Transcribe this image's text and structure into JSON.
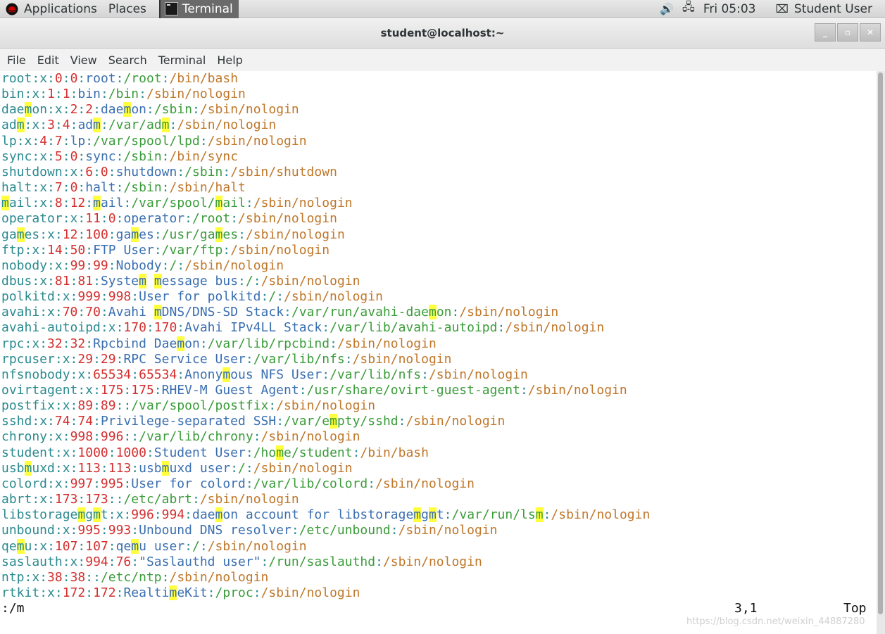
{
  "top_panel": {
    "applications": "Applications",
    "places": "Places",
    "taskbar_terminal": "Terminal",
    "clock": "Fri 05:03",
    "user": "Student User",
    "icons": [
      "redhat-icon",
      "terminal-icon",
      "volume-icon",
      "network-icon",
      "user-icon"
    ]
  },
  "window": {
    "title": "student@localhost:~",
    "controls": [
      "_",
      "▫",
      "✕"
    ]
  },
  "menubar": [
    "File",
    "Edit",
    "View",
    "Search",
    "Terminal",
    "Help"
  ],
  "terminal": {
    "lines": [
      "root:x:0:0:root:/root:/bin/bash",
      "bin:x:1:1:bin:/bin:/sbin/nologin",
      "daemon:x:2:2:daemon:/sbin:/sbin/nologin",
      "adm:x:3:4:adm:/var/adm:/sbin/nologin",
      "lp:x:4:7:lp:/var/spool/lpd:/sbin/nologin",
      "sync:x:5:0:sync:/sbin:/bin/sync",
      "shutdown:x:6:0:shutdown:/sbin:/sbin/shutdown",
      "halt:x:7:0:halt:/sbin:/sbin/halt",
      "mail:x:8:12:mail:/var/spool/mail:/sbin/nologin",
      "operator:x:11:0:operator:/root:/sbin/nologin",
      "games:x:12:100:games:/usr/games:/sbin/nologin",
      "ftp:x:14:50:FTP User:/var/ftp:/sbin/nologin",
      "nobody:x:99:99:Nobody:/:/sbin/nologin",
      "dbus:x:81:81:System message bus:/:/sbin/nologin",
      "polkitd:x:999:998:User for polkitd:/:/sbin/nologin",
      "avahi:x:70:70:Avahi mDNS/DNS-SD Stack:/var/run/avahi-daemon:/sbin/nologin",
      "avahi-autoipd:x:170:170:Avahi IPv4LL Stack:/var/lib/avahi-autoipd:/sbin/nologin",
      "rpc:x:32:32:Rpcbind Daemon:/var/lib/rpcbind:/sbin/nologin",
      "rpcuser:x:29:29:RPC Service User:/var/lib/nfs:/sbin/nologin",
      "nfsnobody:x:65534:65534:Anonymous NFS User:/var/lib/nfs:/sbin/nologin",
      "ovirtagent:x:175:175:RHEV-M Guest Agent:/usr/share/ovirt-guest-agent:/sbin/nologin",
      "postfix:x:89:89::/var/spool/postfix:/sbin/nologin",
      "sshd:x:74:74:Privilege-separated SSH:/var/empty/sshd:/sbin/nologin",
      "chrony:x:998:996::/var/lib/chrony:/sbin/nologin",
      "student:x:1000:1000:Student User:/home/student:/bin/bash",
      "usbmuxd:x:113:113:usbmuxd user:/:/sbin/nologin",
      "colord:x:997:995:User for colord:/var/lib/colord:/sbin/nologin",
      "abrt:x:173:173::/etc/abrt:/sbin/nologin",
      "libstoragemgmt:x:996:994:daemon account for libstoragemgmt:/var/run/lsm:/sbin/nologin",
      "unbound:x:995:993:Unbound DNS resolver:/etc/unbound:/sbin/nologin",
      "qemu:x:107:107:qemu user:/:/sbin/nologin",
      "saslauth:x:994:76:\"Saslauthd user\":/run/saslauthd:/sbin/nologin",
      "ntp:x:38:38::/etc/ntp:/sbin/nologin",
      "rtkit:x:172:172:RealtimeKit:/proc:/sbin/nologin"
    ],
    "search_pattern": "m",
    "status_command": ":/m",
    "cursor_position": "3,1",
    "scroll_position": "Top",
    "colors": {
      "field": "#2a8a8f",
      "number": "#d32f2f",
      "gecos": "#3a6fb0",
      "home": "#3a9c3a",
      "shell": "#c0772a",
      "highlight": "#ffff3d"
    }
  },
  "watermark": "https://blog.csdn.net/weixin_44887280"
}
